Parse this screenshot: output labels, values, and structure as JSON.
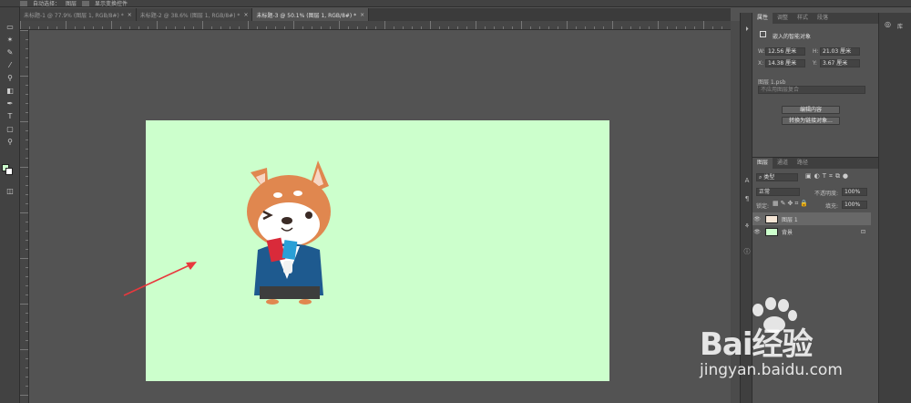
{
  "options_bar": {
    "auto_select_label": "自动选择：",
    "auto_select_value": "图层",
    "show_transform_label": "显示变换控件"
  },
  "tabs": [
    {
      "label": "未标题-1 @ 77.9% (图层 1, RGB/8#) *",
      "close": "×"
    },
    {
      "label": "未标题-2 @ 38.6% (图层 1, RGB/8#) *",
      "close": "×"
    },
    {
      "label": "未标题-3 @ 50.1% (图层 1, RGB/8#) *",
      "close": "×"
    }
  ],
  "properties_panel": {
    "tabs": [
      "属性",
      "调整",
      "样式",
      "段落"
    ],
    "object_type": "嵌入的智能对象",
    "w_label": "W:",
    "w_value": "12.56 厘米",
    "h_label": "H:",
    "h_value": "21.03 厘米",
    "x_label": "X:",
    "x_value": "14.38 厘米",
    "y_label": "Y:",
    "y_value": "3.67 厘米",
    "file_name": "图层 1.psb",
    "comp_placeholder": "不应用图层复合",
    "edit_contents_button": "编辑内容",
    "convert_linked_button": "转换为链接对象..."
  },
  "layers_panel": {
    "tabs": [
      "图层",
      "通道",
      "路径"
    ],
    "filter_value": "类型",
    "blend_mode": "正常",
    "opacity_label": "不透明度:",
    "opacity_value": "100%",
    "lock_label": "锁定:",
    "fill_label": "填充:",
    "fill_value": "100%",
    "layers": [
      {
        "name": "图层 1",
        "selected": true
      },
      {
        "name": "背景",
        "selected": false
      }
    ]
  },
  "libraries_panel": {
    "label": "库"
  },
  "watermark": {
    "brand": "Bai经验",
    "site": "jingyan.baidu.com"
  },
  "colors": {
    "canvas": "#ccffcc",
    "arrow": "#e8383d",
    "panel_bg": "#535353",
    "dark_bg": "#424242"
  }
}
